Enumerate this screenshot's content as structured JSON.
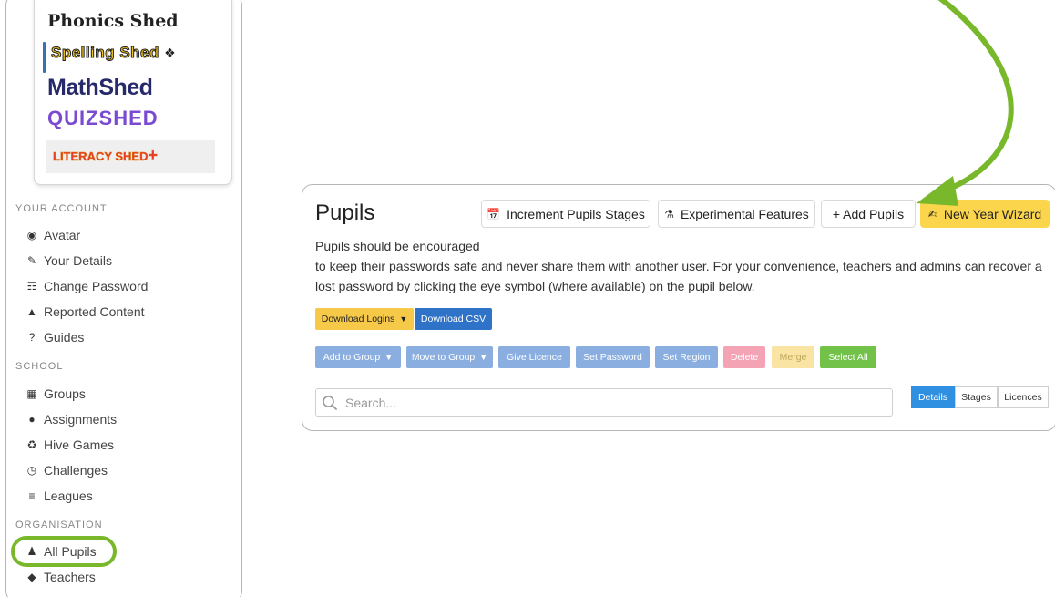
{
  "sidebar": {
    "brands": {
      "phonics": "Phonics Shed",
      "spelling": "Spelling Shed",
      "math": "MathShed",
      "quiz": "QUIZSHED",
      "literacy": "LITERACY SHED",
      "literacy_plus": "+"
    },
    "sections": {
      "account": "YOUR ACCOUNT",
      "school": "SCHOOL",
      "organisation": "ORGANISATION"
    },
    "account_items": [
      {
        "label": "Avatar",
        "icon": "user-circle-icon"
      },
      {
        "label": "Your Details",
        "icon": "user-edit-icon"
      },
      {
        "label": "Change Password",
        "icon": "user-lock-icon"
      },
      {
        "label": "Reported Content",
        "icon": "warning-icon"
      },
      {
        "label": "Guides",
        "icon": "question-icon"
      }
    ],
    "school_items": [
      {
        "label": "Groups",
        "icon": "table-icon"
      },
      {
        "label": "Assignments",
        "icon": "clock-icon"
      },
      {
        "label": "Hive Games",
        "icon": "sitemap-icon"
      },
      {
        "label": "Challenges",
        "icon": "clock-outline-icon"
      },
      {
        "label": "Leagues",
        "icon": "list-icon"
      }
    ],
    "organisation_items": [
      {
        "label": "All Pupils",
        "icon": "users-icon"
      },
      {
        "label": "Teachers",
        "icon": "graduation-cap-icon"
      }
    ]
  },
  "main": {
    "title": "Pupils",
    "header_buttons": {
      "increment": "Increment Pupils Stages",
      "experimental": "Experimental Features",
      "add_pupils": "+ Add Pupils",
      "new_year": "New Year Wizard"
    },
    "description_line1": "Pupils should be encouraged",
    "description_line2": "to keep their passwords safe and never share them with another user. For your convenience, teachers and admins can recover a lost password by clicking the eye symbol (where available) on the pupil below.",
    "download_logins": "Download Logins",
    "download_csv": "Download CSV",
    "actions": {
      "add_to_group": "Add to Group",
      "move_to_group": "Move to Group",
      "give_licence": "Give Licence",
      "set_password": "Set Password",
      "set_region": "Set Region",
      "delete": "Delete",
      "merge": "Merge",
      "select_all": "Select All"
    },
    "search_placeholder": "Search...",
    "view_tabs": {
      "details": "Details",
      "stages": "Stages",
      "licences": "Licences"
    },
    "active_tab": "Details"
  },
  "colors": {
    "accent_green": "#78b82a",
    "primary_blue": "#2f73c9",
    "warning_yellow": "#fbd64d"
  }
}
